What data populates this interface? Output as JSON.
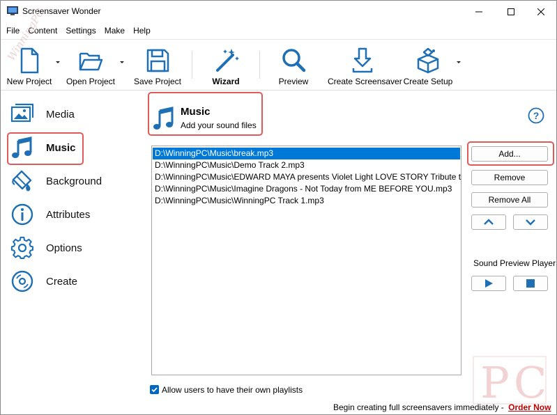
{
  "window": {
    "title": "Screensaver Wonder"
  },
  "menu": [
    "File",
    "Content",
    "Settings",
    "Make",
    "Help"
  ],
  "toolbar": {
    "new_project": "New Project",
    "open_project": "Open Project",
    "save_project": "Save Project",
    "wizard": "Wizard",
    "preview": "Preview",
    "create_screensaver": "Create Screensaver",
    "create_setup": "Create Setup"
  },
  "nav": {
    "media": "Media",
    "music": "Music",
    "background": "Background",
    "attributes": "Attributes",
    "options": "Options",
    "create": "Create"
  },
  "section": {
    "title": "Music",
    "subtitle": "Add your sound files"
  },
  "files": [
    "D:\\WinningPC\\Music\\break.mp3",
    "D:\\WinningPC\\Music\\Demo Track 2.mp3",
    "D:\\WinningPC\\Music\\EDWARD MAYA presents Violet Light LOVE STORY Tribute to N",
    "D:\\WinningPC\\Music\\Imagine Dragons - Not Today from ME BEFORE YOU.mp3",
    "D:\\WinningPC\\Music\\WinningPC Track 1.mp3"
  ],
  "buttons": {
    "add": "Add...",
    "remove": "Remove",
    "remove_all": "Remove All"
  },
  "player": {
    "label": "Sound Preview Player"
  },
  "options": {
    "allow_playlists": "Allow users to have their own playlists",
    "allow_playlists_checked": true
  },
  "footer": {
    "promo": "Begin creating full screensavers immediately -",
    "order_link": "Order Now"
  },
  "watermark": {
    "text": "WinningPC"
  },
  "colors": {
    "accent": "#0078d7",
    "icon_blue": "#1e6fb4",
    "highlight": "#e05a5a",
    "link": "#c00000"
  }
}
